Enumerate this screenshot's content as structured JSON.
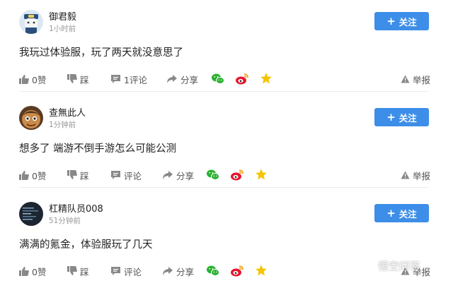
{
  "comments": [
    {
      "username": "御君毅",
      "time": "1小时前",
      "follow_label": "关注",
      "content": "我玩过体验服，玩了两天就没意思了",
      "like_label": "0赞",
      "dislike_label": "踩",
      "comment_label": "1评论",
      "share_label": "分享",
      "report_label": "举报"
    },
    {
      "username": "查無此人",
      "time": "1分钟前",
      "follow_label": "关注",
      "content": "想多了 端游不倒手游怎么可能公测",
      "like_label": "0赞",
      "dislike_label": "踩",
      "comment_label": "评论",
      "share_label": "分享",
      "report_label": "举报"
    },
    {
      "username": "杠精队员008",
      "time": "51分钟前",
      "follow_label": "关注",
      "content": "满满的氪金，体验服玩了几天",
      "like_label": "0赞",
      "dislike_label": "踩",
      "comment_label": "评论",
      "share_label": "分享",
      "report_label": "举报"
    }
  ],
  "watermark": "悟空问答",
  "colors": {
    "follow_button": "#3d8ee8",
    "wechat": "#2ab130",
    "weibo": "#e6162d",
    "star": "#f5c400",
    "muted_text": "#999999"
  }
}
